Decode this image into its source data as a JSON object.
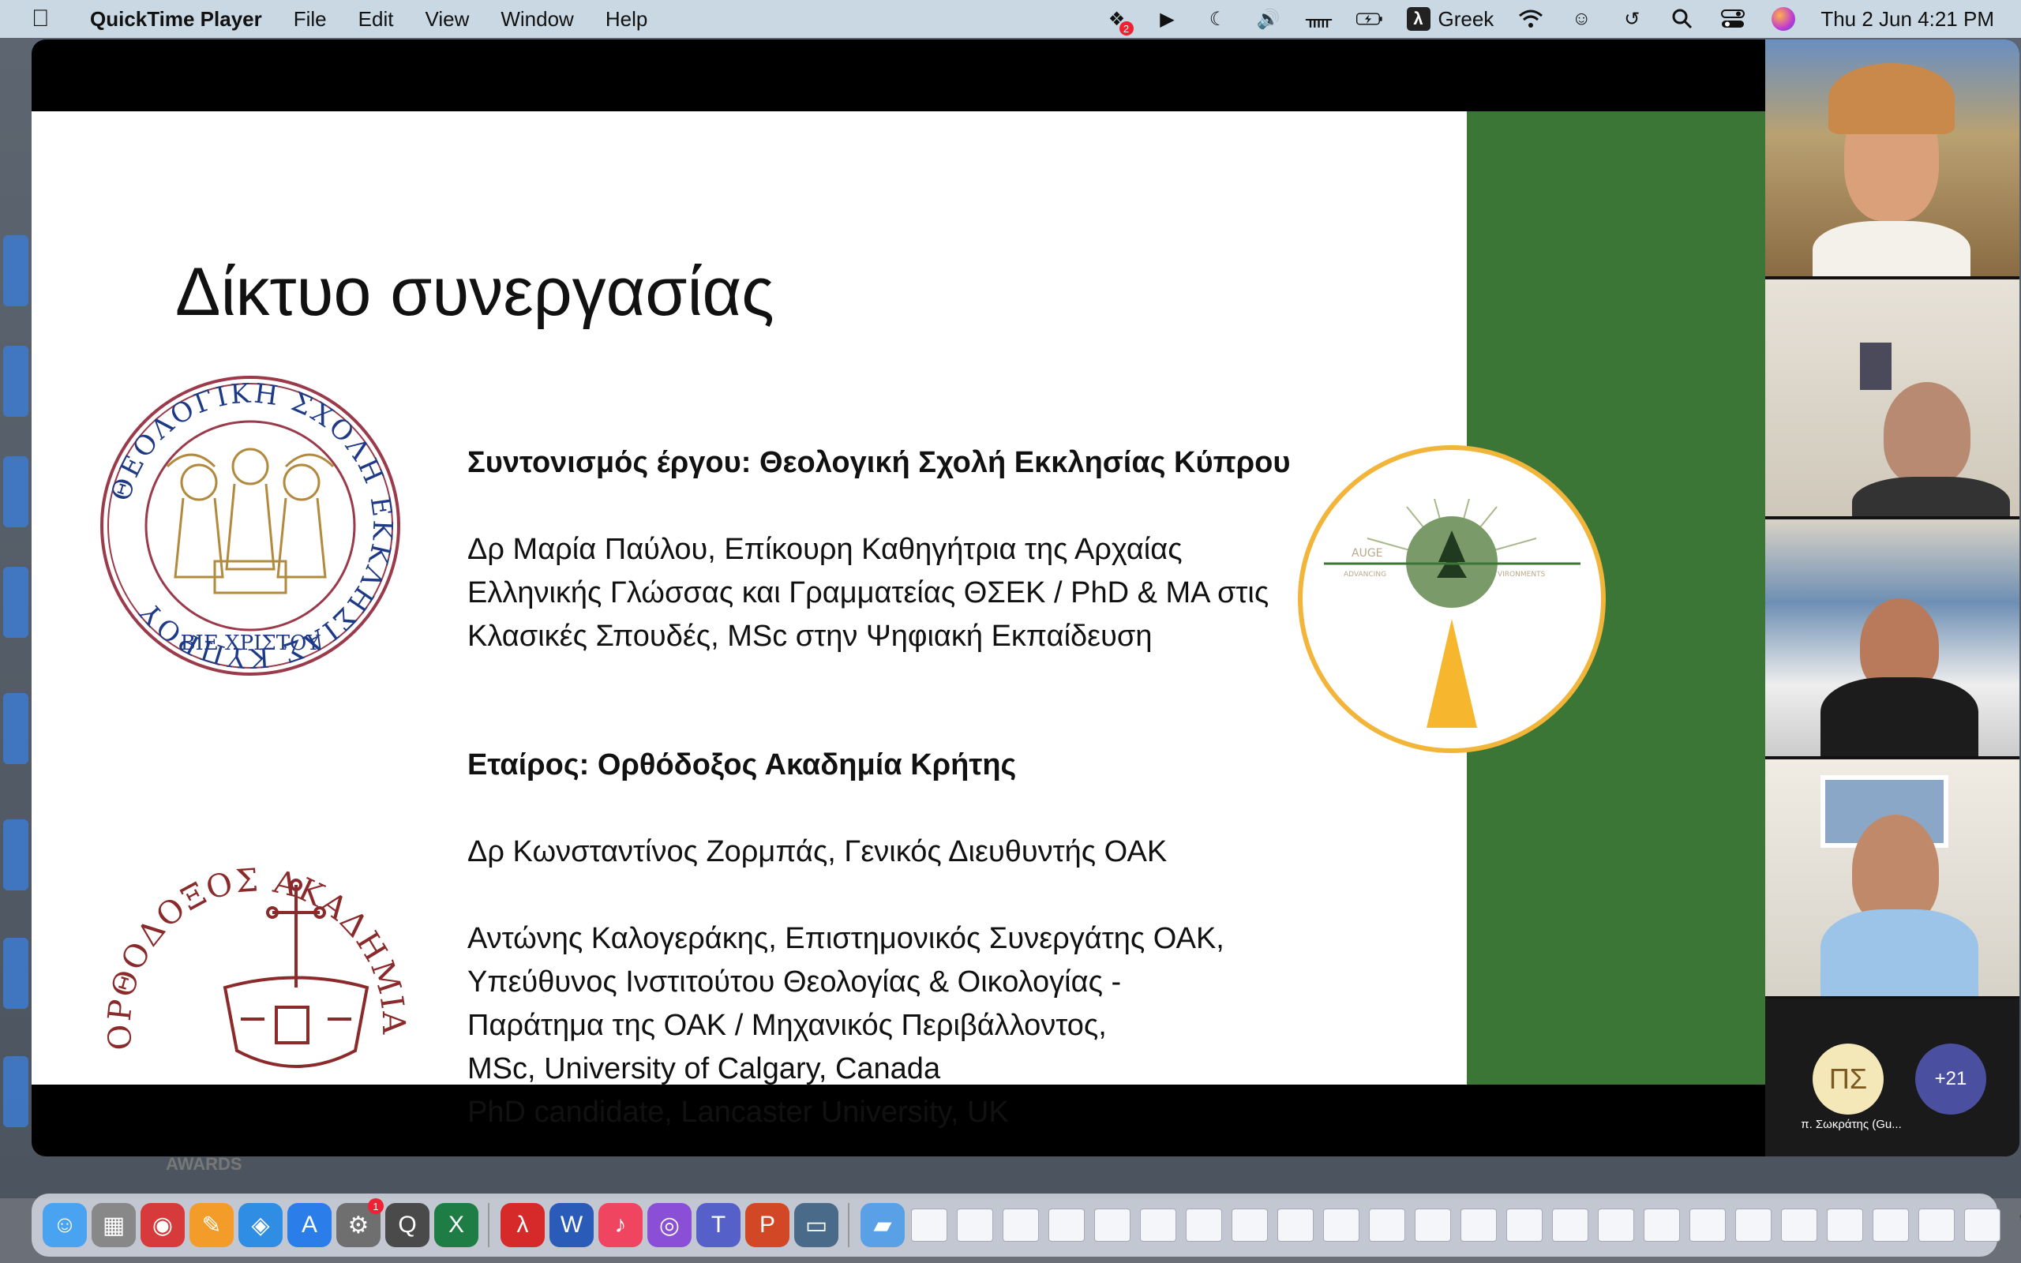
{
  "menubar": {
    "app_name": "QuickTime Player",
    "menus": [
      "File",
      "Edit",
      "View",
      "Window",
      "Help"
    ],
    "input_source": "Greek",
    "clock": "Thu 2 Jun  4:21 PM",
    "dropbox_badge": "2"
  },
  "slide": {
    "title": "Δίκτυο συνεργασίας",
    "coordination_heading": "Συντονισμός έργου: Θεολογική Σχολή Εκκλησίας Κύπρου",
    "coordination_person": [
      "Δρ Μαρία Παύλου, Επίκουρη Καθηγήτρια της Αρχαίας",
      "Ελληνικής Γλώσσας και Γραμματείας ΘΣΕΚ / PhD & MA στις",
      "Κλασικές Σπουδές, MSc στην Ψηφιακή Εκπαίδευση"
    ],
    "partner_heading": "Εταίρος: Ορθόδοξος Ακαδημία Κρήτης",
    "partner_person1": "Δρ Κωνσταντίνος Ζορμπάς, Γενικός Διευθυντής ΟΑΚ",
    "partner_person2": [
      "Αντώνης Καλογεράκης, Επιστημονικός Συνεργάτης ΟΑΚ,",
      "Υπεύθυνος  Ινστιτούτου Θεολογίας & Οικολογίας -",
      "Παράτημα της ΟΑΚ / Μηχανικός Περιβάλλοντος,",
      "MSc, University of Calgary, Canada",
      "PhD candidate, Lancaster University, UK"
    ],
    "logo1_text": "ΘΕΟΛΟΓΙΚΗ ΣΧΟΛΗ ΕΚΚΛΗΣΙΑΣ ΚΥΠΡΟΥ",
    "logo1_bottom": "ΒΙΕ ΧΡΙΣΤΟΥ",
    "logo2_text": "ΟΡΘΟΔΟΞΟΣ ΑΚΑΔΗΜΙΑ ΚΡΗΤΗΣ",
    "auge_title": "AUGE",
    "auge_sub_left": "ADVANCING",
    "auge_sub_right": "VIRONMENTS"
  },
  "participants": {
    "ps_initials": "ΠΣ",
    "ps_name": "π. Σωκράτης (Gu...",
    "more_count": "+21"
  },
  "desktop": {
    "awards_label": "AWARDS"
  },
  "dock": {
    "mail_badge": "1"
  },
  "colors": {
    "green_band": "#3c7637",
    "auge_ring": "#f2b53a",
    "logo1": "#9a3a4a",
    "logo2": "#8b2a2a"
  }
}
